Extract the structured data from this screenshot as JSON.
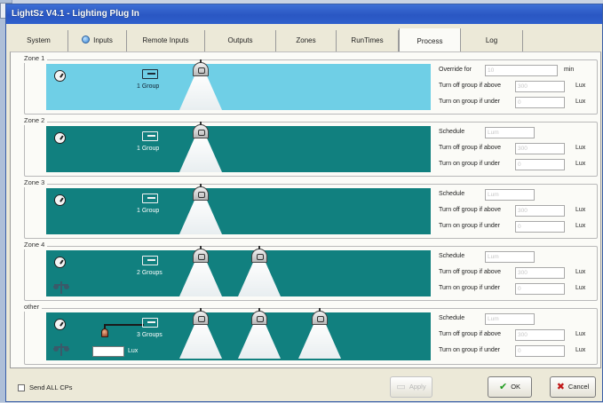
{
  "window": {
    "title": "LightSz V4.1 - Lighting Plug In"
  },
  "tabs": [
    "System",
    "Inputs",
    "Remote Inputs",
    "Outputs",
    "Zones",
    "RunTimes",
    "Process",
    "Log"
  ],
  "zones": [
    {
      "label": "Zone 1",
      "group": "1 Group",
      "rows": [
        {
          "label": "Override for",
          "value": "10",
          "unit": "min"
        },
        {
          "label": "Turn off group if above",
          "value": "300",
          "unit": "Lux"
        },
        {
          "label": "Turn on group if under",
          "value": "0",
          "unit": "Lux"
        }
      ]
    },
    {
      "label": "Zone 2",
      "group": "1 Group",
      "rows": [
        {
          "label": "Schedule",
          "value": "Lum",
          "unit": ""
        },
        {
          "label": "Turn off group if above",
          "value": "300",
          "unit": "Lux"
        },
        {
          "label": "Turn on group if under",
          "value": "0",
          "unit": "Lux"
        }
      ]
    },
    {
      "label": "Zone 3",
      "group": "1 Group",
      "rows": [
        {
          "label": "Schedule",
          "value": "Lum",
          "unit": ""
        },
        {
          "label": "Turn off group if above",
          "value": "300",
          "unit": "Lux"
        },
        {
          "label": "Turn on group if under",
          "value": "0",
          "unit": "Lux"
        }
      ]
    },
    {
      "label": "Zone 4",
      "group": "2 Groups",
      "rows": [
        {
          "label": "Schedule",
          "value": "Lum",
          "unit": ""
        },
        {
          "label": "Turn off group if above",
          "value": "300",
          "unit": "Lux"
        },
        {
          "label": "Turn on group if under",
          "value": "0",
          "unit": "Lux"
        }
      ]
    },
    {
      "label": "other",
      "group": "3 Groups",
      "lux_unit": "Lux",
      "rows": [
        {
          "label": "Schedule",
          "value": "Lum",
          "unit": ""
        },
        {
          "label": "Turn off group if above",
          "value": "300",
          "unit": "Lux"
        },
        {
          "label": "Turn on group if under",
          "value": "0",
          "unit": "Lux"
        }
      ]
    }
  ],
  "footer": {
    "send_all": "Send ALL CPs",
    "apply": "Apply",
    "ok": "OK",
    "cancel": "Cancel"
  },
  "colors": {
    "zone_light": "#6fcfe6",
    "zone_dark": "#11807f",
    "titlebar": "#2a57c3"
  }
}
